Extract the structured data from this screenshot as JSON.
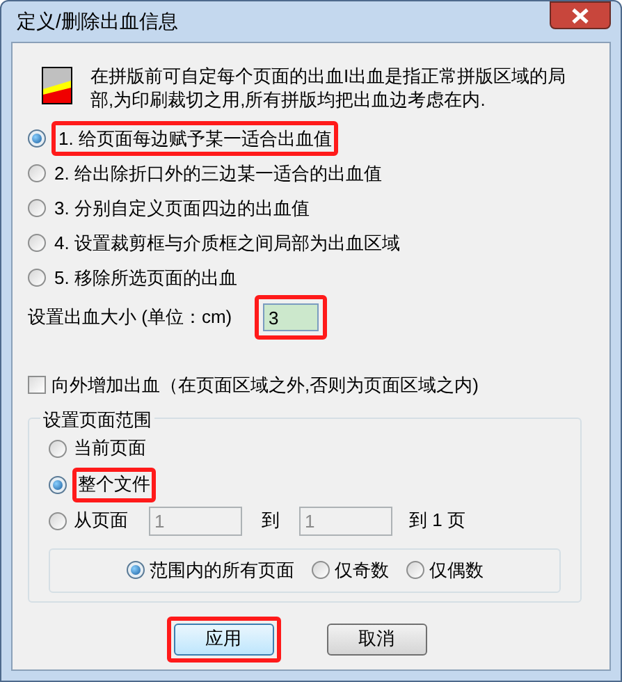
{
  "window": {
    "title": "定义/删除出血信息"
  },
  "description": "在拼版前可自定每个页面的出血I出血是指正常拼版区域的局部,为印刷裁切之用,所有拼版均把出血边考虑在内.",
  "modes": [
    {
      "label": "1. 给页面每边赋予某一适合出血值",
      "selected": true,
      "highlighted": true
    },
    {
      "label": "2. 给出除折口外的三边某一适合的出血值",
      "selected": false,
      "highlighted": false
    },
    {
      "label": "3. 分别自定义页面四边的出血值",
      "selected": false,
      "highlighted": false
    },
    {
      "label": "4. 设置裁剪框与介质框之间局部为出血区域",
      "selected": false,
      "highlighted": false
    },
    {
      "label": "5. 移除所选页面的出血",
      "selected": false,
      "highlighted": false
    }
  ],
  "bleed_size": {
    "label": "设置出血大小 (单位：cm)",
    "value": "3",
    "highlighted": true
  },
  "outward": {
    "label": "向外增加出血（在页面区域之外,否则为页面区域之内)",
    "checked": false
  },
  "page_range": {
    "title": "设置页面范围",
    "options": [
      {
        "kind": "plain",
        "label": "当前页面",
        "selected": false,
        "highlighted": false
      },
      {
        "kind": "plain",
        "label": "整个文件",
        "selected": true,
        "highlighted": true
      },
      {
        "kind": "range",
        "label": "从页面",
        "from": "1",
        "to_label": "到",
        "to": "1",
        "suffix": "到 1 页",
        "selected": false,
        "highlighted": false
      }
    ],
    "subset": [
      {
        "label": "范围内的所有页面",
        "selected": true
      },
      {
        "label": "仅奇数",
        "selected": false
      },
      {
        "label": "仅偶数",
        "selected": false
      }
    ]
  },
  "buttons": [
    {
      "label": "应用",
      "highlighted": true
    },
    {
      "label": "取消",
      "highlighted": false
    }
  ]
}
